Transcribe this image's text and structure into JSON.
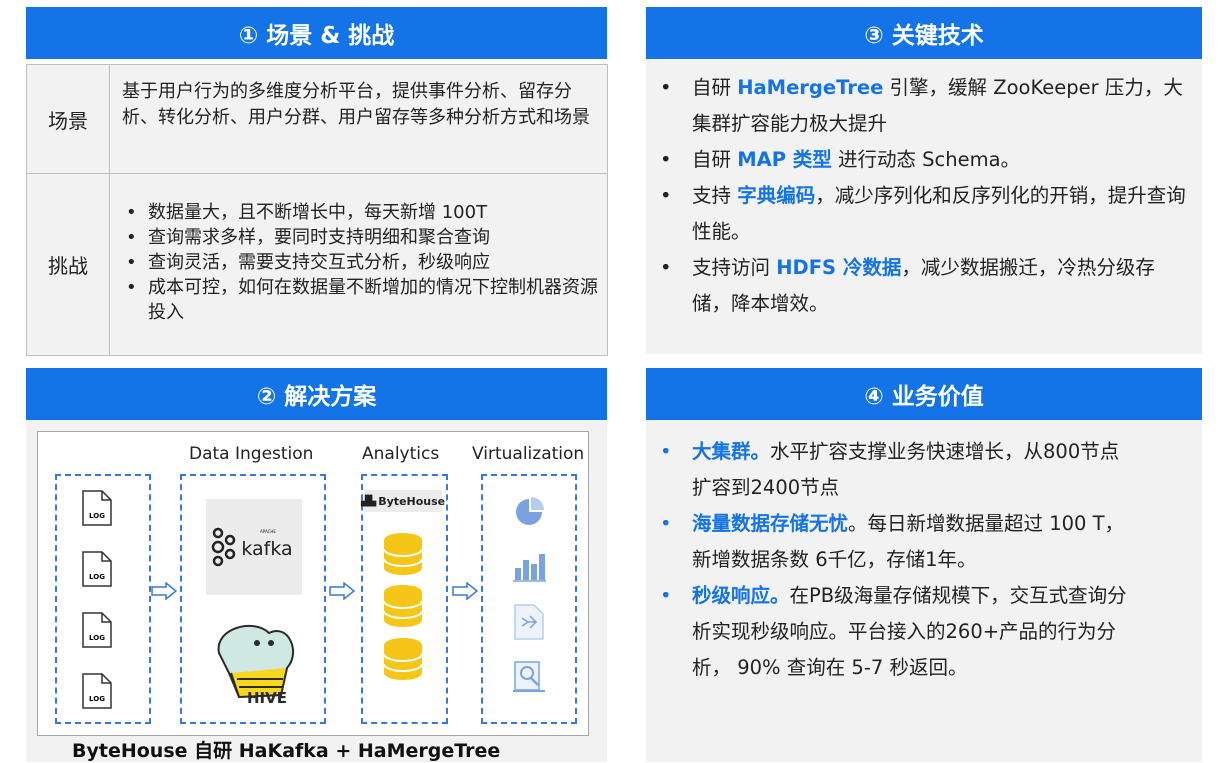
{
  "panel1": {
    "title": "① 场景 & 挑战",
    "scene_label": "场景",
    "scene_text": "基于用户行为的多维度分析平台，提供事件分析、留存分析、转化分析、用户分群、用户留存等多种分析方式和场景",
    "challenge_label": "挑战",
    "challenges": [
      "数据量大，且不断增长中，每天新增 100T",
      "查询需求多样，要同时支持明细和聚合查询",
      "查询灵活，需要支持交互式分析，秒级响应",
      "成本可控，如何在数据量不断增加的情况下控制机器资源投入"
    ]
  },
  "panel2": {
    "title": "② 解决方案",
    "columns": [
      "Data Ingestion",
      "Analytics",
      "Virtualization"
    ],
    "log_label": "LOG",
    "kafka": {
      "apache": "APACHE",
      "name": "kafka"
    },
    "hive_label": "HIVE",
    "bytehouse_label": "ByteHouse",
    "caption": "ByteHouse 自研 HaKafka + HaMergeTree",
    "icons": [
      "document-icon",
      "kafka-logo",
      "hive-logo",
      "bytehouse-logo",
      "database-icon",
      "pie-chart-icon",
      "bar-chart-icon",
      "flow-chart-icon",
      "report-icon",
      "arrow-icon"
    ]
  },
  "panel3": {
    "title": "③ 关键技术",
    "items": [
      {
        "pre": "自研 ",
        "hl": "HaMergeTree",
        "post": " 引擎，缓解 ZooKeeper 压力，大集群扩容能力极大提升"
      },
      {
        "pre": "自研 ",
        "hl": "MAP 类型",
        "post": " 进行动态 Schema。"
      },
      {
        "pre": "支持 ",
        "hl": "字典编码",
        "post": "，减少序列化和反序列化的开销，提升查询性能。"
      },
      {
        "pre": "支持访问 ",
        "hl": "HDFS 冷数据",
        "post": "，减少数据搬迁，冷热分级存储，降本增效。"
      }
    ]
  },
  "panel4": {
    "title": "④ 业务价值",
    "items": [
      {
        "hl": "大集群。",
        "post": "水平扩容支撑业务快速增长，从800节点扩容到2400节点"
      },
      {
        "hl": "海量数据存储无忧",
        "post": "。每日新增数据量超过 100 T，新增数据条数 6千亿，存储1年。"
      },
      {
        "hl": "秒级响应。",
        "post": "在PB级海量存储规模下，交互式查询分析实现秒级响应。平台接入的260+产品的行为分析， 90% 查询在 5-7 秒返回。"
      }
    ]
  },
  "colors": {
    "accent": "#1473e6",
    "panel_bg": "#f2f2f2",
    "db_yellow": "#f5c518"
  }
}
